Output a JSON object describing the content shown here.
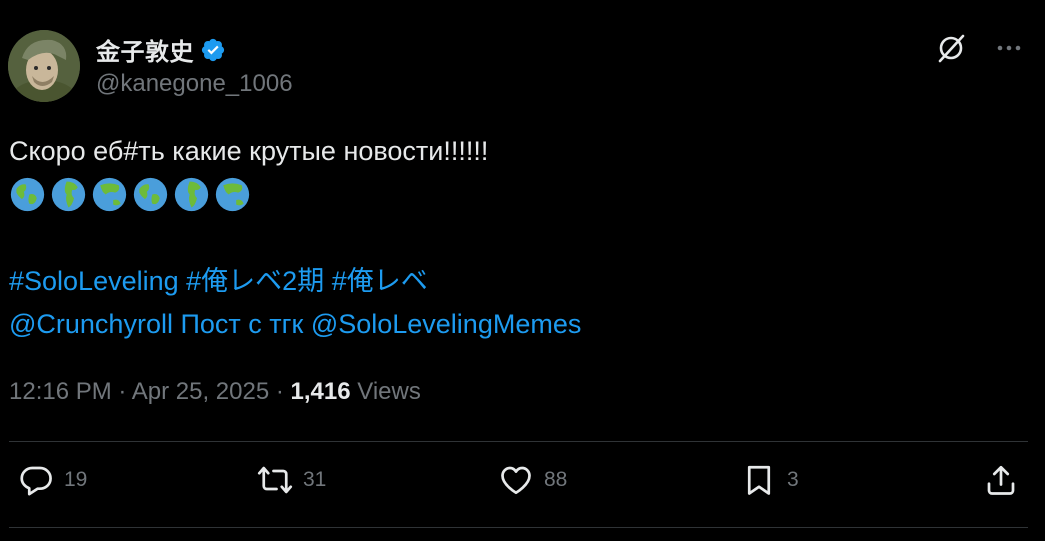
{
  "author": {
    "display_name": "金子敦史",
    "handle": "@kanegone_1006",
    "verified": true
  },
  "tweet": {
    "text": "Скоро еб#ть какие крутые новости!!!!!!",
    "emoji": [
      "🌎",
      "🌍",
      "🌏",
      "🌎",
      "🌍",
      "🌏"
    ],
    "hashtag_1": "#SoloLeveling",
    "hashtag_2": "#俺レベ2期",
    "hashtag_3": "#俺レベ",
    "mention_1": "@Crunchyroll",
    "inline_text": "Пост с тгк",
    "mention_2": "@SoloLevelingMemes"
  },
  "meta": {
    "time": "12:16 PM",
    "separator": "·",
    "date": "Apr 25, 2025",
    "views_count": "1,416",
    "views_label": "Views"
  },
  "actions": {
    "replies": "19",
    "reposts": "31",
    "likes": "88",
    "bookmarks": "3"
  },
  "colors": {
    "background": "#000000",
    "text": "#e7e9ea",
    "secondary": "#71767b",
    "link": "#1d9bf0",
    "divider": "#2f3336",
    "verified": "#1d9bf0"
  },
  "icons": [
    "grok-icon",
    "more-icon",
    "verified-badge-icon",
    "reply-icon",
    "repost-icon",
    "like-icon",
    "bookmark-icon",
    "share-icon",
    "earth-globe-icon"
  ]
}
